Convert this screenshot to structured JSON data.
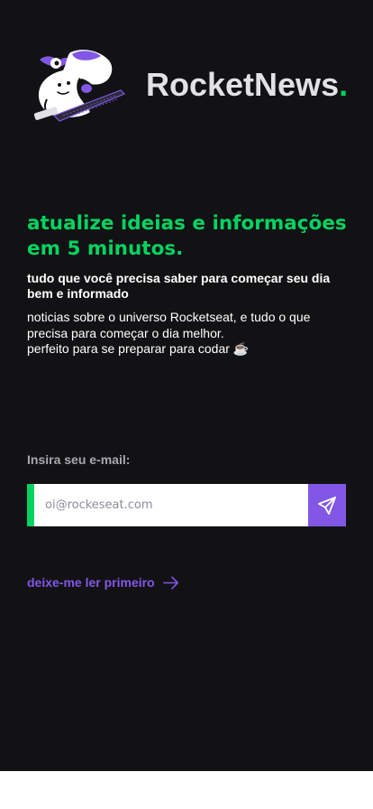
{
  "app": {
    "brand_name": "RocketNews",
    "brand_dot": "."
  },
  "hero": {
    "headline": "atualize ideias e informações em 5 minutos.",
    "subheadline": "tudo que você precisa saber para começar seu dia bem e informado",
    "description_line1": "noticias sobre o universo Rocketseat, e tudo o que precisa para começar o dia melhor.",
    "description_line2": "perfeito para se preparar para codar ☕"
  },
  "signup": {
    "label": "Insira seu e-mail:",
    "email_placeholder": "oi@rockeseat.com",
    "email_value": "",
    "send_icon": "send-icon"
  },
  "links": {
    "read_first_label": "deixe-me ler primeiro",
    "read_first_icon": "arrow-right-icon"
  },
  "colors": {
    "background": "#121214",
    "accent_green": "#04d361",
    "accent_purple": "#8257e5",
    "text_light": "#e1e1e6",
    "text_muted": "#a8a8b3"
  },
  "illustration": {
    "icon": "astronaut-reading-illustration"
  }
}
